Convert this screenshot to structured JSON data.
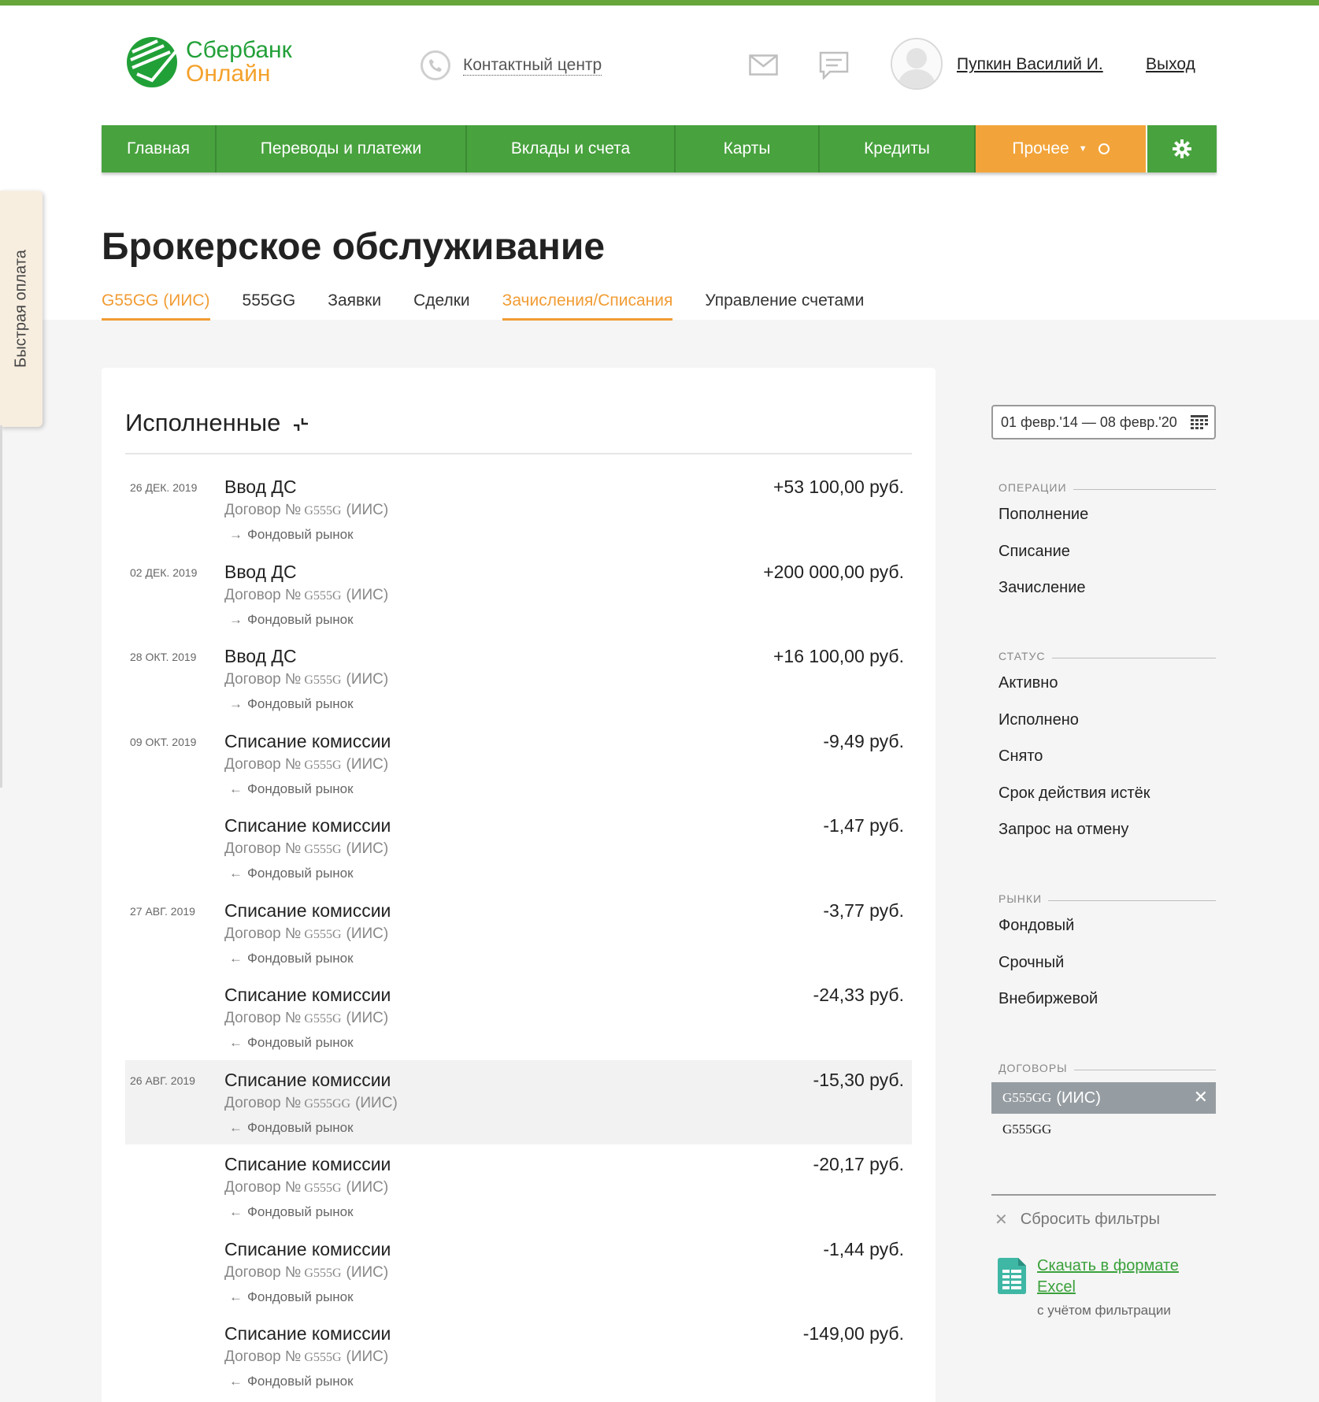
{
  "header": {
    "logo_line1": "Сбербанк",
    "logo_line2": "Онлайн",
    "contact_center": "Контактный центр",
    "user_name": "Пупкин Василий И.",
    "logout": "Выход",
    "icons": [
      "phone-icon",
      "mail-icon",
      "chat-icon",
      "avatar"
    ]
  },
  "nav": {
    "items": [
      "Главная",
      "Переводы и платежи",
      "Вклады и счета",
      "Карты",
      "Кредиты",
      "Прочее"
    ],
    "settings_icon": "gear-icon"
  },
  "side_tab": "Быстрая оплата",
  "page": {
    "title": "Брокерское обслуживание",
    "tabs": [
      "G55GG (ИИС)",
      "555GG",
      "Заявки",
      "Сделки",
      "Зачисления/Списания",
      "Управление счетами"
    ],
    "active_tabs": [
      "G55GG (ИИС)",
      "Зачисления/Списания"
    ]
  },
  "operations": {
    "title": "Исполненные",
    "items": [
      {
        "date": "26 ДЕК. 2019",
        "title": "Ввод ДС",
        "contract_label": "Договор №",
        "contract_num": "G555G",
        "contract_type": "(ИИС)",
        "arrow": "→",
        "market": "Фондовый рынок",
        "amount": "+53 100,00 руб."
      },
      {
        "date": "02 ДЕК. 2019",
        "title": "Ввод ДС",
        "contract_label": "Договор №",
        "contract_num": "G555G",
        "contract_type": "(ИИС)",
        "arrow": "→",
        "market": "Фондовый рынок",
        "amount": "+200 000,00 руб."
      },
      {
        "date": "28 ОКТ. 2019",
        "title": "Ввод ДС",
        "contract_label": "Договор №",
        "contract_num": "G555G",
        "contract_type": "(ИИС)",
        "arrow": "→",
        "market": "Фондовый рынок",
        "amount": "+16 100,00 руб."
      },
      {
        "date": "09 ОКТ. 2019",
        "title": "Списание комиссии",
        "contract_label": "Договор №",
        "contract_num": "G555G",
        "contract_type": "(ИИС)",
        "arrow": "←",
        "market": "Фондовый рынок",
        "amount": "-9,49 руб."
      },
      {
        "date": "",
        "title": "Списание комиссии",
        "contract_label": "Договор №",
        "contract_num": "G555G",
        "contract_type": "(ИИС)",
        "arrow": "←",
        "market": "Фондовый рынок",
        "amount": "-1,47 руб."
      },
      {
        "date": "27 АВГ. 2019",
        "title": "Списание комиссии",
        "contract_label": "Договор №",
        "contract_num": "G555G",
        "contract_type": "(ИИС)",
        "arrow": "←",
        "market": "Фондовый рынок",
        "amount": "-3,77 руб."
      },
      {
        "date": "",
        "title": "Списание комиссии",
        "contract_label": "Договор №",
        "contract_num": "G555G",
        "contract_type": "(ИИС)",
        "arrow": "←",
        "market": "Фондовый рынок",
        "amount": "-24,33 руб."
      },
      {
        "date": "26 АВГ. 2019",
        "title": "Списание комиссии",
        "contract_label": "Договор №",
        "contract_num": "G555GG",
        "contract_type": "(ИИС)",
        "arrow": "←",
        "market": "Фондовый рынок",
        "amount": "-15,30 руб.",
        "highlighted": true
      },
      {
        "date": "",
        "title": "Списание комиссии",
        "contract_label": "Договор №",
        "contract_num": "G555G",
        "contract_type": "(ИИС)",
        "arrow": "←",
        "market": "Фондовый рынок",
        "amount": "-20,17 руб."
      },
      {
        "date": "",
        "title": "Списание комиссии",
        "contract_label": "Договор №",
        "contract_num": "G555G",
        "contract_type": "(ИИС)",
        "arrow": "←",
        "market": "Фондовый рынок",
        "amount": "-1,44 руб."
      },
      {
        "date": "",
        "title": "Списание комиссии",
        "contract_label": "Договор №",
        "contract_num": "G555G",
        "contract_type": "(ИИС)",
        "arrow": "←",
        "market": "Фондовый рынок",
        "amount": "-149,00 руб."
      }
    ]
  },
  "filters": {
    "date_range": "01 февр.'14 — 08 февр.'20",
    "operations_header": "ОПЕРАЦИИ",
    "operations": [
      "Пополнение",
      "Списание",
      "Зачисление"
    ],
    "status_header": "СТАТУС",
    "statuses": [
      "Активно",
      "Исполнено",
      "Снято",
      "Срок действия истёк",
      "Запрос на отмену"
    ],
    "markets_header": "РЫНКИ",
    "markets": [
      "Фондовый",
      "Срочный",
      "Внебиржевой"
    ],
    "contracts_header": "ДОГОВОРЫ",
    "selected_contract_num": "G555GG",
    "selected_contract_type": "(ИИС)",
    "selected_remove": "✕",
    "contract_option": "G555GG",
    "reset_icon": "✕",
    "reset": "Сбросить фильтры",
    "excel_line1": "Скачать в формате",
    "excel_line2": "Excel",
    "excel_note": "с учётом фильтрации"
  },
  "colors": {
    "brand_green": "#48a23e",
    "accent_orange": "#f2a43a",
    "tab_active": "#f19c34",
    "link_green": "#3aa13b"
  }
}
